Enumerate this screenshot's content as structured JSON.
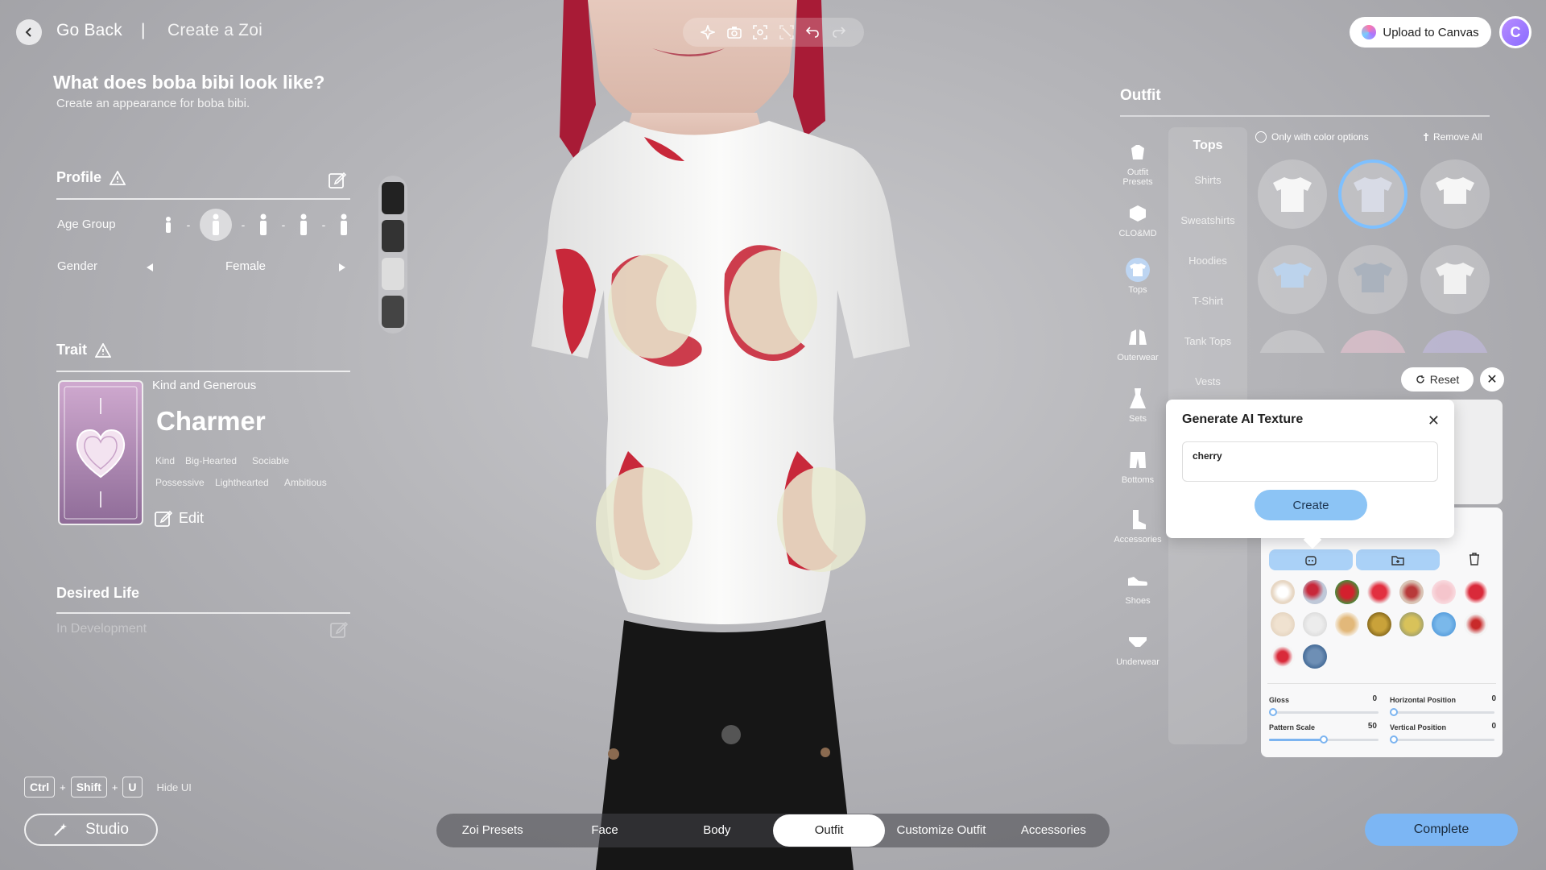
{
  "header": {
    "back_label": "Go Back",
    "separator": "|",
    "breadcrumb": "Create a Zoi",
    "toolbar_icons": [
      "sparkle-icon",
      "camera-icon",
      "focus-icon",
      "crop-icon",
      "undo-icon",
      "redo-icon"
    ],
    "upload_label": "Upload to Canvas",
    "avatar_letter": "C"
  },
  "intro": {
    "title": "What does boba bibi look like?",
    "subtitle": "Create an appearance for boba bibi."
  },
  "profile": {
    "title": "Profile",
    "age_label": "Age Group",
    "gender_label": "Gender",
    "gender_value": "Female"
  },
  "trait": {
    "title": "Trait",
    "subtitle": "Kind and Generous",
    "name": "Charmer",
    "tags_row1": [
      "Kind",
      "Big-Hearted",
      "Sociable"
    ],
    "tags_row2": [
      "Possessive",
      "Lighthearted",
      "Ambitious"
    ],
    "edit_label": "Edit"
  },
  "desired": {
    "title": "Desired Life",
    "status": "In Development"
  },
  "shortcut": {
    "keys": [
      "Ctrl",
      "Shift",
      "U"
    ],
    "plus": "+",
    "label": "Hide UI"
  },
  "studio_label": "Studio",
  "tabs": [
    "Zoi Presets",
    "Face",
    "Body",
    "Outfit",
    "Customize Outfit",
    "Accessories"
  ],
  "active_tab": "Outfit",
  "complete_label": "Complete",
  "outfit": {
    "title": "Outfit",
    "categories": [
      "Outfit Presets",
      "CLO&MD",
      "Tops",
      "Outerwear",
      "Sets",
      "Bottoms",
      "Accessories",
      "Shoes",
      "Underwear"
    ],
    "active_category": "Tops",
    "subcategory_title": "Tops",
    "subcategories": [
      "Shirts",
      "Sweatshirts",
      "Hoodies",
      "T-Shirt",
      "Tank Tops",
      "Vests"
    ],
    "only_color_label": "Only with color options",
    "remove_all_label": "Remove All",
    "reset_label": "Reset"
  },
  "ai_texture": {
    "title": "Generate AI Texture",
    "prompt_value": "cherry",
    "create_label": "Create"
  },
  "texture_controls": {
    "gloss_label": "Gloss",
    "gloss_value": "0",
    "horizontal_label": "Horizontal Position",
    "horizontal_value": "0",
    "pattern_label": "Pattern Scale",
    "pattern_value": "50",
    "vertical_label": "Vertical Position",
    "vertical_value": "0",
    "pattern_fraction": 0.5
  },
  "colors": {
    "accent": "#7cb6f4",
    "shirt": "#f4f4f2",
    "cherry": "#c8283a",
    "hair": "#b01e3a"
  }
}
